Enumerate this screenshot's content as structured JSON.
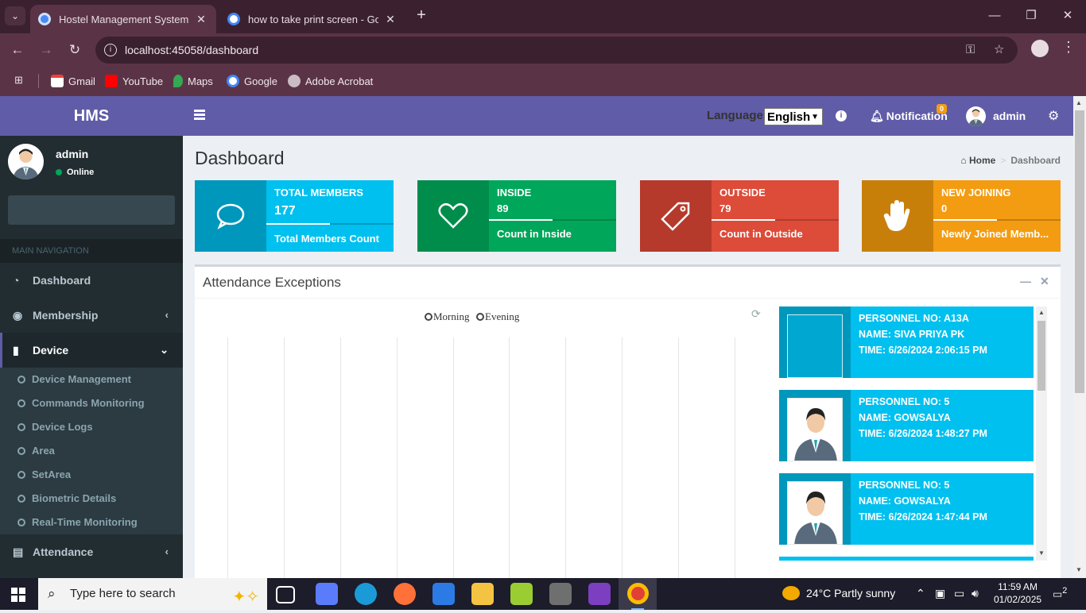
{
  "browser": {
    "tabs": [
      {
        "title": "Hostel Management System | D",
        "active": true
      },
      {
        "title": "how to take print screen - Goog",
        "active": false
      }
    ],
    "url": "localhost:45058/dashboard",
    "bookmarks": [
      {
        "label": "Gmail",
        "icon": "gmail-icon"
      },
      {
        "label": "YouTube",
        "icon": "youtube-icon"
      },
      {
        "label": "Maps",
        "icon": "maps-icon"
      },
      {
        "label": "Google",
        "icon": "google-icon"
      },
      {
        "label": "Adobe Acrobat",
        "icon": "acrobat-icon"
      }
    ]
  },
  "header": {
    "logo": "HMS",
    "language_label": "Language",
    "language_value": "English",
    "notification_label": "Notification",
    "notification_count": "0",
    "user_name": "admin"
  },
  "sidebar": {
    "user": {
      "name": "admin",
      "status": "Online"
    },
    "section_header": "MAIN NAVIGATION",
    "items": [
      {
        "label": "Dashboard"
      },
      {
        "label": "Membership"
      },
      {
        "label": "Device"
      },
      {
        "label": "Attendance"
      }
    ],
    "device_submenu": [
      {
        "label": "Device Management"
      },
      {
        "label": "Commands Monitoring"
      },
      {
        "label": "Device Logs"
      },
      {
        "label": "Area"
      },
      {
        "label": "SetArea"
      },
      {
        "label": "Biometric Details"
      },
      {
        "label": "Real-Time Monitoring"
      }
    ]
  },
  "page": {
    "title": "Dashboard",
    "breadcrumb": {
      "home": "Home",
      "current": "Dashboard"
    }
  },
  "info_boxes": [
    {
      "label": "TOTAL MEMBERS",
      "value": "177",
      "desc": "Total Members Count",
      "progress": 0.5,
      "icon": "comment-icon",
      "icon_bg": "#0097bc",
      "bg": "#00c0ef"
    },
    {
      "label": "INSIDE",
      "value": "89",
      "desc": "Count in Inside",
      "progress": 0.5,
      "icon": "heart-icon",
      "icon_bg": "#008d4c",
      "bg": "#00a65a"
    },
    {
      "label": "OUTSIDE",
      "value": "79",
      "desc": "Count in Outside",
      "progress": 0.5,
      "icon": "tag-icon",
      "icon_bg": "#b53a2b",
      "bg": "#dd4b39"
    },
    {
      "label": "NEW JOINING",
      "value": "0",
      "desc": "Newly Joined Memb...",
      "progress": 0.5,
      "icon": "hand-icon",
      "icon_bg": "#c87f0a",
      "bg": "#f39c12"
    }
  ],
  "attendance": {
    "title": "Attendance Exceptions",
    "legend": [
      "Morning",
      "Evening"
    ],
    "feed": [
      {
        "personnel": "PERSONNEL NO: A13A",
        "name": "NAME: SIVA PRIYA PK",
        "time": "TIME: 6/26/2024 2:06:15 PM",
        "photo": "broken"
      },
      {
        "personnel": "PERSONNEL NO: 5",
        "name": "NAME: GOWSALYA",
        "time": "TIME: 6/26/2024 1:48:27 PM",
        "photo": "avatar"
      },
      {
        "personnel": "PERSONNEL NO: 5",
        "name": "NAME: GOWSALYA",
        "time": "TIME: 6/26/2024 1:47:44 PM",
        "photo": "avatar"
      }
    ]
  },
  "taskbar": {
    "search_placeholder": "Type here to search",
    "weather": "24°C  Partly sunny",
    "time": "11:59 AM",
    "date": "01/02/2025",
    "notification_count": "2"
  }
}
